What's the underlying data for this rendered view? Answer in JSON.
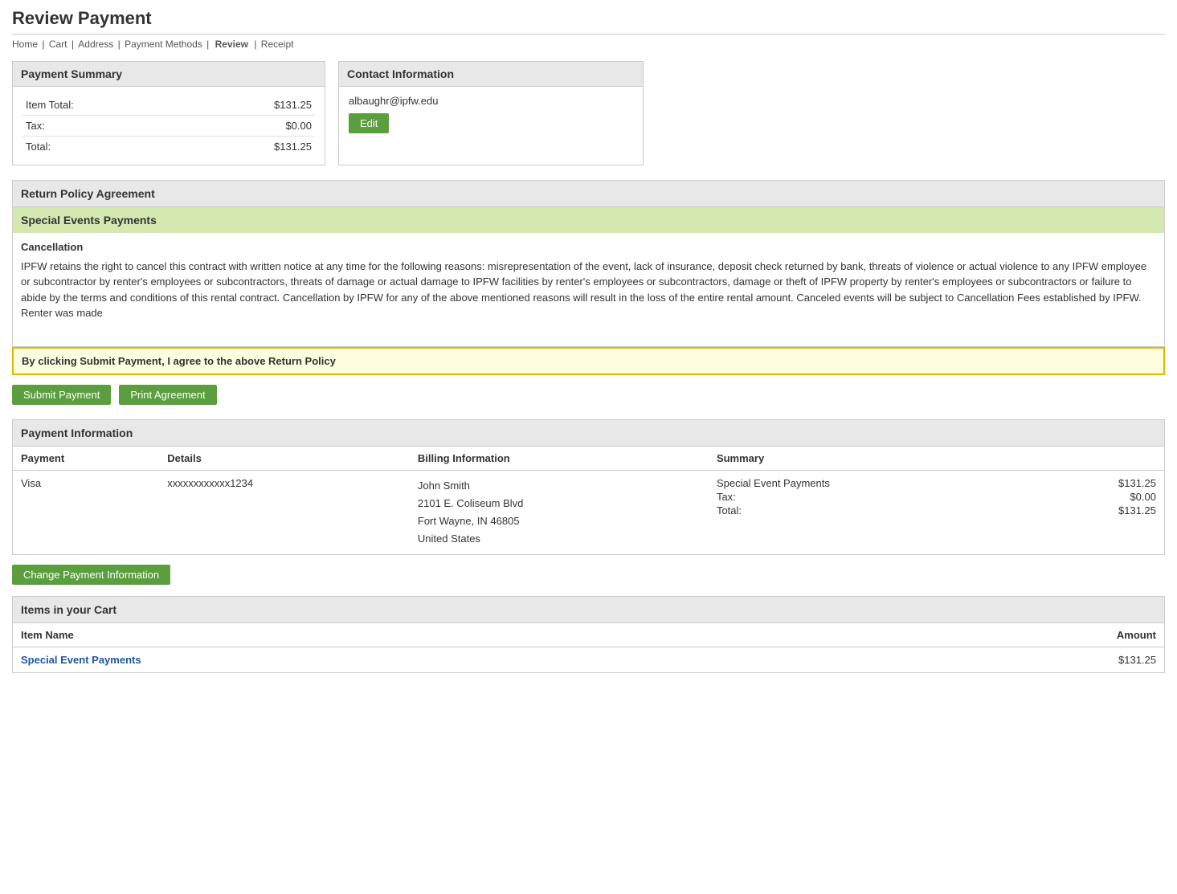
{
  "page": {
    "title": "Review Payment"
  },
  "breadcrumb": {
    "items": [
      {
        "label": "Home",
        "active": false
      },
      {
        "label": "Cart",
        "active": false
      },
      {
        "label": "Address",
        "active": false
      },
      {
        "label": "Payment Methods",
        "active": false
      },
      {
        "label": "Review",
        "active": true
      },
      {
        "label": "Receipt",
        "active": false
      }
    ],
    "separator": "|"
  },
  "payment_summary": {
    "title": "Payment Summary",
    "rows": [
      {
        "label": "Item Total:",
        "value": "$131.25"
      },
      {
        "label": "Tax:",
        "value": "$0.00"
      },
      {
        "label": "Total:",
        "value": "$131.25"
      }
    ]
  },
  "contact_info": {
    "title": "Contact Information",
    "email": "albaughr@ipfw.edu",
    "edit_label": "Edit"
  },
  "return_policy": {
    "section_title": "Return Policy Agreement",
    "policy_title": "Special Events Payments",
    "cancellation_label": "Cancellation",
    "cancellation_text": "IPFW retains the right to cancel this contract with written notice at any time for the following reasons: misrepresentation of the event, lack of insurance, deposit check returned by bank, threats of violence or actual violence to any IPFW employee or subcontractor by renter's employees or subcontractors, threats of damage or actual damage to IPFW facilities by renter's employees or subcontractors, damage or theft of IPFW property by renter's employees or subcontractors or failure to abide by the terms and conditions of this rental contract. Cancellation by IPFW for any of the above mentioned reasons will result in the loss of the entire rental amount. Canceled events will be subject to Cancellation Fees established by IPFW. Renter was made",
    "agree_text": "By clicking Submit Payment, I agree to the above Return Policy"
  },
  "actions": {
    "submit_label": "Submit Payment",
    "print_label": "Print Agreement"
  },
  "payment_info": {
    "title": "Payment Information",
    "columns": {
      "payment": "Payment",
      "details": "Details",
      "billing": "Billing Information",
      "summary": "Summary"
    },
    "row": {
      "payment_type": "Visa",
      "card_number": "xxxxxxxxxxxx1234",
      "billing_lines": [
        "John Smith",
        "2101 E. Coliseum Blvd",
        "Fort Wayne, IN 46805",
        "United States"
      ],
      "summary_rows": [
        {
          "label": "Special Event Payments",
          "value": "$131.25"
        },
        {
          "label": "Tax:",
          "value": "$0.00"
        },
        {
          "label": "Total:",
          "value": "$131.25"
        }
      ]
    }
  },
  "change_payment": {
    "label": "Change Payment Information"
  },
  "cart": {
    "title": "Items in your Cart",
    "columns": {
      "item_name": "Item Name",
      "amount": "Amount"
    },
    "rows": [
      {
        "name": "Special Event Payments",
        "amount": "$131.25",
        "link": true
      }
    ]
  }
}
